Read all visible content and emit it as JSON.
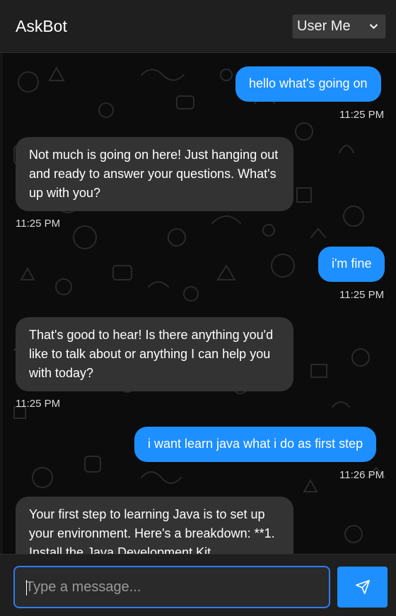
{
  "header": {
    "title": "AskBot",
    "user_select_value": "User Me"
  },
  "messages": [
    {
      "role": "user",
      "text": "hello what's going on",
      "time": "11:25 PM"
    },
    {
      "role": "bot",
      "text": "Not much is going on here! Just hanging out and ready to answer your questions. What's up with you?",
      "time": "11:25 PM"
    },
    {
      "role": "user",
      "text": "i'm fine",
      "time": "11:25 PM"
    },
    {
      "role": "bot",
      "text": "That's good to hear! Is there anything you'd like to talk about or anything I can help you with today?",
      "time": "11:25 PM"
    },
    {
      "role": "user",
      "text": "i want learn java what i do as first step",
      "time": "11:26 PM"
    },
    {
      "role": "bot",
      "text": "Your first step to learning Java is to set up your environment. Here's a breakdown: **1. Install the Java Development Kit",
      "time": ""
    }
  ],
  "composer": {
    "placeholder": "Type a message...",
    "value": "",
    "send_icon": "send-icon"
  },
  "colors": {
    "accent": "#1e8ffe",
    "bot_bubble": "#333333",
    "header": "#1f1f1f",
    "background": "#0c0c0c"
  }
}
